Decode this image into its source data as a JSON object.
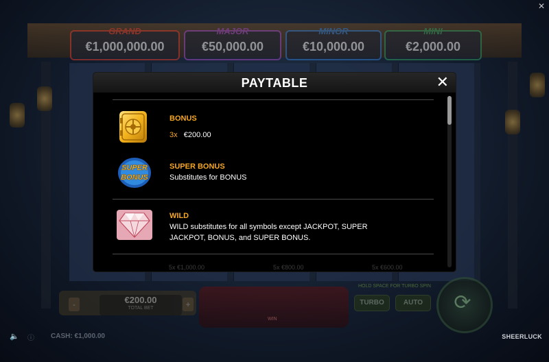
{
  "jackpots": [
    {
      "name": "GRAND",
      "value": "€1,000,000.00",
      "color": "#c0392b"
    },
    {
      "name": "MAJOR",
      "value": "€50,000.00",
      "color": "#8e44ad"
    },
    {
      "name": "MINOR",
      "value": "€10,000.00",
      "color": "#2f6fb7"
    },
    {
      "name": "MINI",
      "value": "€2,000.00",
      "color": "#2e8b57"
    }
  ],
  "paytable": {
    "title": "PAYTABLE",
    "close_label": "✕",
    "symbols": [
      {
        "name": "BONUS",
        "multiplier": "3x",
        "payout": "€200.00",
        "icon": "bonus-vault-icon"
      },
      {
        "name": "SUPER BONUS",
        "description": "Substitutes for BONUS",
        "icon": "super-bonus-icon",
        "icon_text_1": "SUPER",
        "icon_text_2": "BONUS"
      },
      {
        "name": "WILD",
        "description_line1": "WILD substitutes for all symbols except JACKPOT, SUPER",
        "description_line2": "JACKPOT, BONUS, and SUPER BONUS.",
        "icon": "diamond-wild-icon"
      }
    ],
    "peek": [
      "5x  €1,000.00",
      "5x  €800.00",
      "5x  €600.00"
    ]
  },
  "bottom_bar": {
    "bet_value": "€200.00",
    "bet_label": "TOTAL BET",
    "minus_label": "-",
    "plus_label": "+",
    "win_label": "WIN",
    "hold_label": "HOLD SPACE FOR TURBO SPIN",
    "turbo_label": "TURBO",
    "auto_label": "AUTO",
    "cash_label": "CASH:",
    "cash_value": "€1,000.00",
    "brand": "SHEERLUCK"
  },
  "colors": {
    "accent": "#f5a623",
    "modal_bg": "#000000"
  }
}
